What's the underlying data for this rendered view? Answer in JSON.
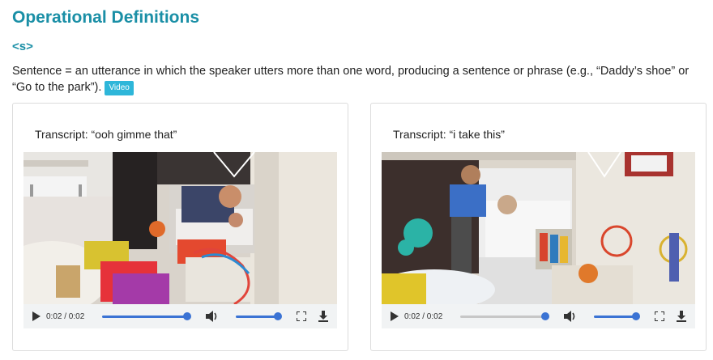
{
  "header": {
    "title": "Operational Definitions",
    "code": "<s>"
  },
  "definition": {
    "text": "Sentence = an utterance in which the speaker utters more than one word, producing a sentence or phrase (e.g., “Daddy’s shoe” or “Go to the park”).",
    "video_badge": "Video"
  },
  "cards": [
    {
      "transcript": "Transcript: “ooh gimme that”",
      "player": {
        "time": "0:02 / 0:02",
        "progress": 1.0,
        "volume": 1.0
      }
    },
    {
      "transcript": "Transcript: “i take this”",
      "player": {
        "time": "0:02 / 0:02",
        "progress": 1.0,
        "volume": 1.0
      }
    }
  ],
  "colors": {
    "accent": "#1a8fa6",
    "badge": "#2eb6d9",
    "slider": "#3b73d4"
  },
  "icons": [
    "play-icon",
    "volume-icon",
    "fullscreen-icon",
    "download-icon"
  ]
}
